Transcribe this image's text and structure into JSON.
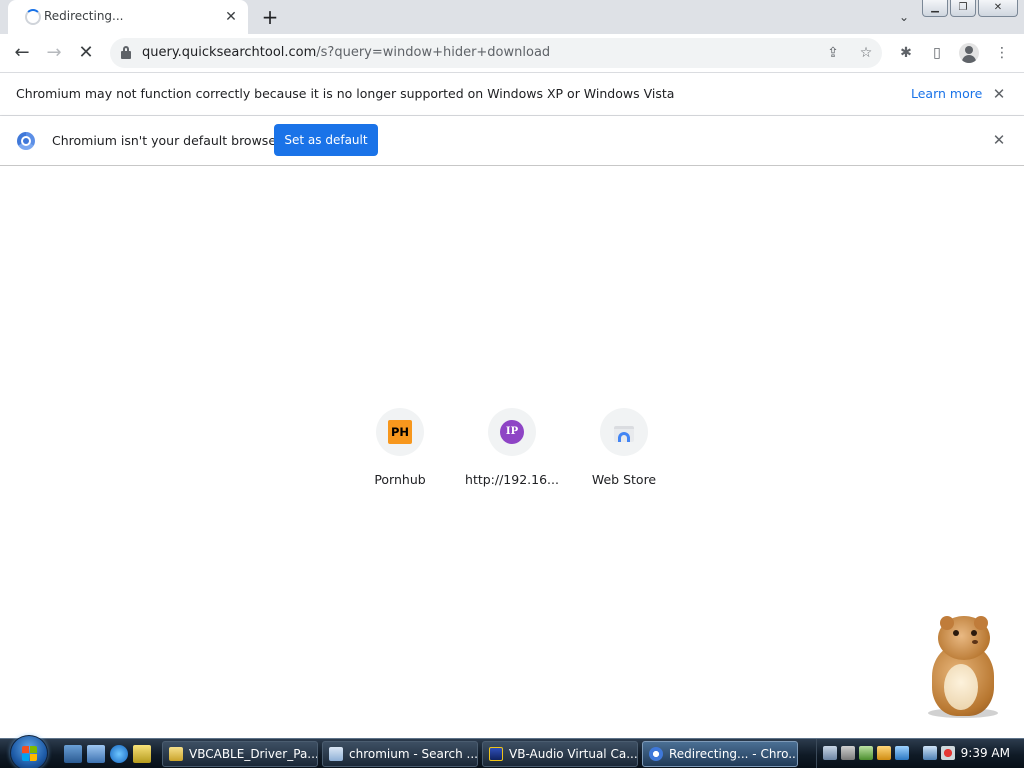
{
  "browser": {
    "tab": {
      "title": "Redirecting...",
      "close_glyph": "✕"
    },
    "new_tab_glyph": "+",
    "tab_search_glyph": "⌄",
    "window_buttons": {
      "minimize": "▁",
      "restore": "❐",
      "close": "✕"
    },
    "toolbar": {
      "back_glyph": "←",
      "forward_glyph": "→",
      "stop_glyph": "✕",
      "url_host": "query.quicksearchtool.com",
      "url_path": "/s?query=window+hider+download",
      "share_glyph": "⇪",
      "bookmark_glyph": "☆",
      "extensions_glyph": "✱",
      "side_panel_glyph": "▯",
      "menu_glyph": "⋮"
    },
    "infobar_warning": {
      "message": "Chromium may not function correctly because it is no longer supported on Windows XP or Windows Vista",
      "link": "Learn more",
      "close_glyph": "✕"
    },
    "infobar_default": {
      "message": "Chromium isn't your default browser",
      "button": "Set as default",
      "close_glyph": "✕"
    }
  },
  "new_tab_page": {
    "shortcuts": [
      {
        "label": "Pornhub",
        "icon_text": "PH",
        "icon": "pornhub-favicon"
      },
      {
        "label": "http://192.16...",
        "icon_text": "IP",
        "icon": "ip-address-favicon"
      },
      {
        "label": "Web Store",
        "icon": "web-store-icon"
      }
    ]
  },
  "taskbar": {
    "buttons": [
      {
        "label": "VBCABLE_Driver_Pa...",
        "icon": "folder-zip-icon"
      },
      {
        "label": "chromium - Search ...",
        "icon": "search-window-icon"
      },
      {
        "label": "VB-Audio Virtual Ca...",
        "icon": "vb-audio-icon"
      },
      {
        "label": "Redirecting... - Chro...",
        "icon": "chromium-icon"
      }
    ],
    "clock": "9:39 AM"
  },
  "colors": {
    "accent": "#1a73e8",
    "tab_strip": "#dee1e6",
    "omnibox": "#f1f3f4",
    "pornhub_orange": "#f7971d",
    "ip_purple": "#8e44c5"
  }
}
